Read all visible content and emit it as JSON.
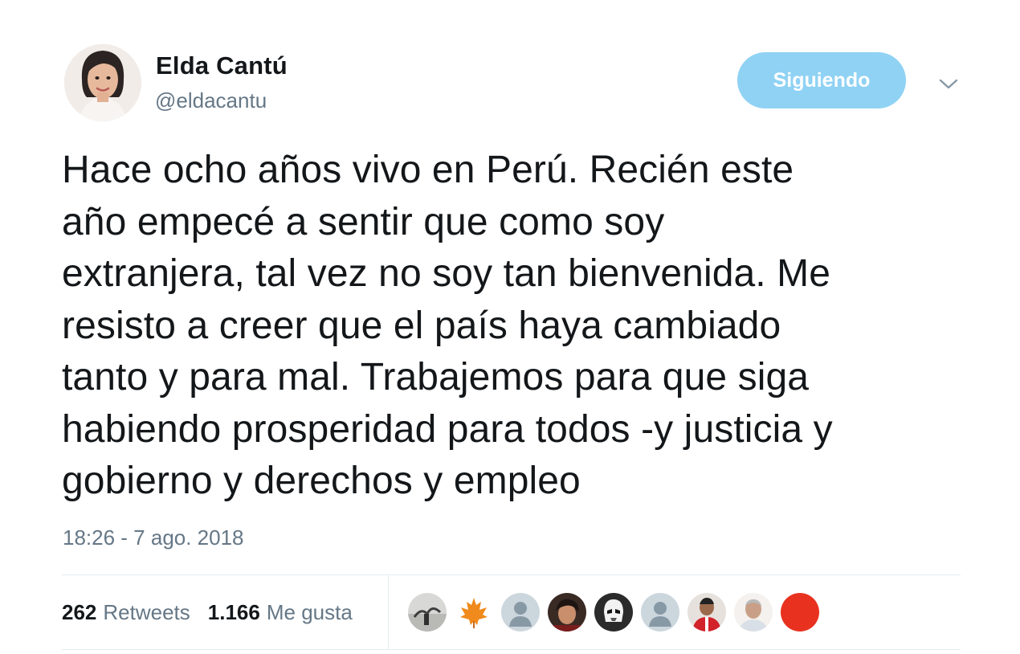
{
  "author": {
    "display_name": "Elda Cantú",
    "handle": "@eldacantu",
    "avatar_icon": "profile-photo-woman"
  },
  "follow_button": {
    "label": "Siguiendo",
    "color": "#8fd2f4"
  },
  "menu": {
    "icon": "chevron-down-icon"
  },
  "tweet": {
    "text": "Hace ocho años vivo en Perú. Recién este\naño empecé a sentir que como soy\nextranjera, tal vez no soy tan bienvenida. Me\nresisto a creer que el país haya cambiado\ntanto y para mal.  Trabajemos para que siga\nhabiendo prosperidad para todos -y justicia y\ngobierno y derechos y empleo",
    "timestamp": "18:26 - 7 ago. 2018"
  },
  "stats": {
    "retweets_count": "262",
    "retweets_label": "Retweets",
    "likes_count": "1.166",
    "likes_label": "Me gusta"
  },
  "likers": [
    {
      "icon": "liker-avatar-photo-1"
    },
    {
      "icon": "liker-avatar-maple-leaf"
    },
    {
      "icon": "liker-avatar-default"
    },
    {
      "icon": "liker-avatar-photo-2"
    },
    {
      "icon": "liker-avatar-stormtrooper"
    },
    {
      "icon": "liker-avatar-default"
    },
    {
      "icon": "liker-avatar-photo-3"
    },
    {
      "icon": "liker-avatar-photo-4"
    },
    {
      "icon": "liker-avatar-red"
    }
  ],
  "colors": {
    "text_primary": "#14171a",
    "text_secondary": "#657786",
    "divider": "#e6ecf0"
  }
}
